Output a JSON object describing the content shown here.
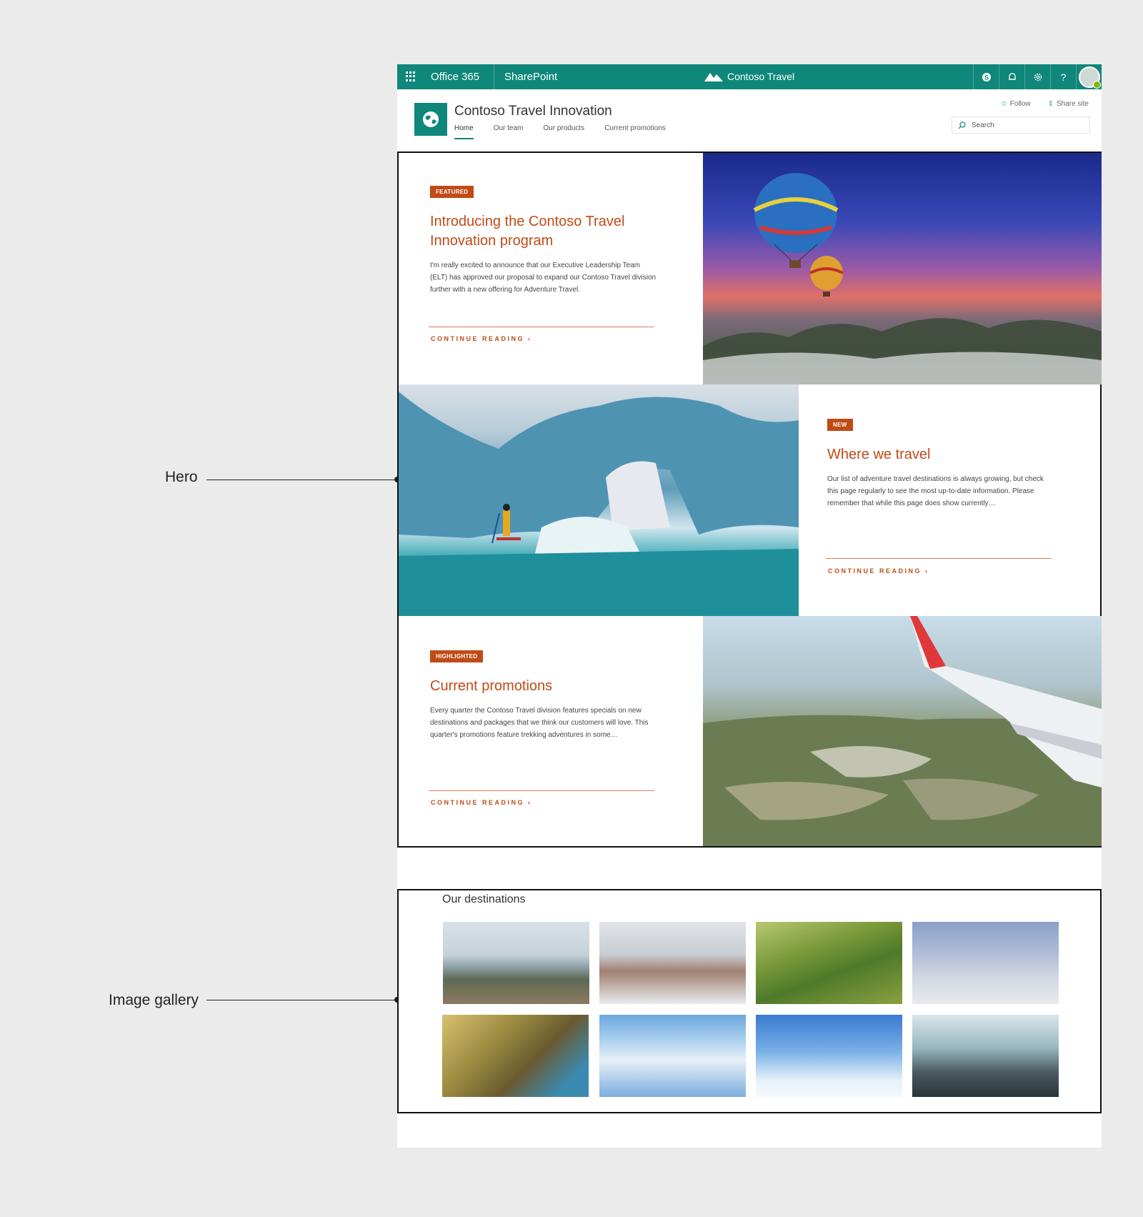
{
  "callouts": {
    "hero": "Hero",
    "gallery": "Image gallery"
  },
  "suite_bar": {
    "app_launcher_icon": "waffle-icon",
    "office": "Office 365",
    "sharepoint": "SharePoint",
    "brand": "Contoso Travel",
    "icons": [
      "skype-icon",
      "notifications-icon",
      "settings-icon",
      "help-icon",
      "avatar"
    ],
    "help_glyph": "?",
    "background": "#0f877a"
  },
  "site": {
    "title": "Contoso Travel Innovation",
    "nav": [
      "Home",
      "Our team",
      "Our products",
      "Current promotions"
    ],
    "active_nav": "Home",
    "follow": "Follow",
    "share": "Share site",
    "search_placeholder": "Search"
  },
  "hero": {
    "accent": "#c04b16",
    "tiles": [
      {
        "badge": "FEATURED",
        "title": "Introducing the Contoso Travel Innovation program",
        "body": "I'm really excited to announce that our Executive Leadership Team (ELT) has approved our proposal to expand our Contoso Travel division further with a new offering for Adventure Travel.",
        "link": "CONTINUE READING ›",
        "image": "hot-air-balloons"
      },
      {
        "badge": "NEW",
        "title": "Where we travel",
        "body": "Our list of adventure travel destinations is always growing, but check this page regularly to see the most up-to-date information. Please remember that while this page does show currently…",
        "link": "CONTINUE READING ›",
        "image": "iceberg-paddleboard"
      },
      {
        "badge": "HIGHLIGHTED",
        "title": "Current promotions",
        "body": "Every quarter the Contoso Travel division features specials on new destinations and packages that we think our customers will love. This quarter's promotions feature trekking adventures in some…",
        "link": "CONTINUE READING ›",
        "image": "airplane-wing-aerial"
      }
    ]
  },
  "gallery": {
    "title": "Our destinations",
    "images": [
      "hikers-lake",
      "woman-winter",
      "rice-terraces",
      "balloons-valley",
      "forest-hiker",
      "salt-flat-car",
      "airplane-clouds",
      "airport-travelers"
    ]
  }
}
